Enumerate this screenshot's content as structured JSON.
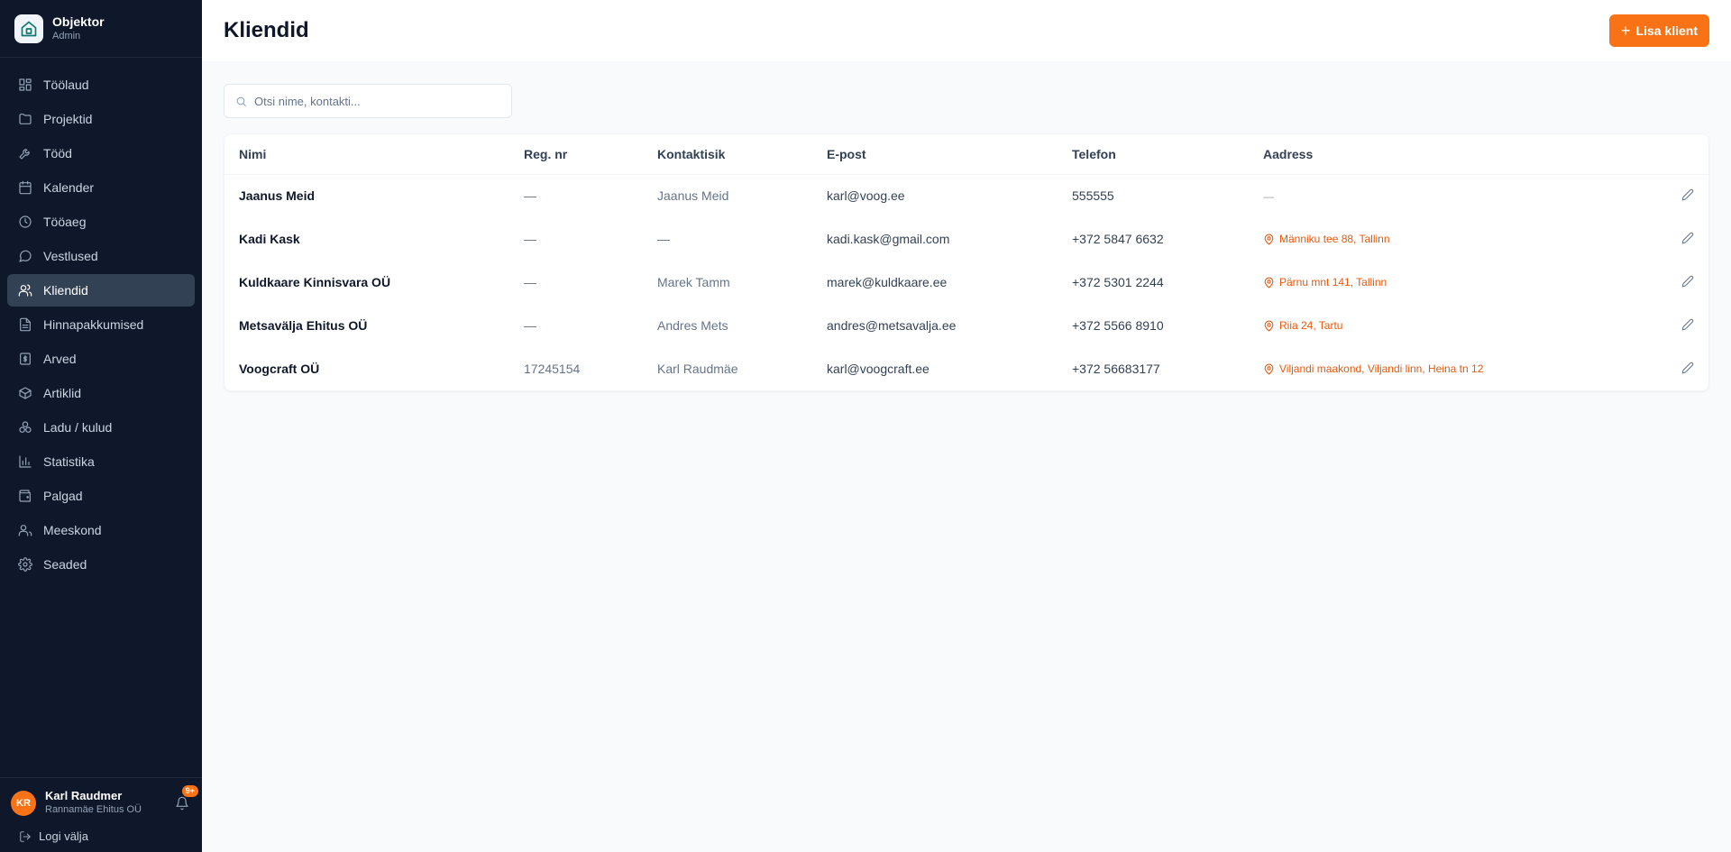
{
  "brand": {
    "name": "Objektor",
    "subtitle": "Admin",
    "logo_icon": "house-icon"
  },
  "sidebar": {
    "items": [
      {
        "label": "Töölaud",
        "icon": "dashboard-icon",
        "active": false
      },
      {
        "label": "Projektid",
        "icon": "folder-icon",
        "active": false
      },
      {
        "label": "Tööd",
        "icon": "wrench-icon",
        "active": false
      },
      {
        "label": "Kalender",
        "icon": "calendar-icon",
        "active": false
      },
      {
        "label": "Tööaeg",
        "icon": "clock-icon",
        "active": false
      },
      {
        "label": "Vestlused",
        "icon": "chat-icon",
        "active": false
      },
      {
        "label": "Kliendid",
        "icon": "users-icon",
        "active": true
      },
      {
        "label": "Hinnapakkumised",
        "icon": "document-icon",
        "active": false
      },
      {
        "label": "Arved",
        "icon": "invoice-icon",
        "active": false
      },
      {
        "label": "Artiklid",
        "icon": "box-icon",
        "active": false
      },
      {
        "label": "Ladu / kulud",
        "icon": "boxes-icon",
        "active": false
      },
      {
        "label": "Statistika",
        "icon": "bar-chart-icon",
        "active": false
      },
      {
        "label": "Palgad",
        "icon": "wallet-icon",
        "active": false
      },
      {
        "label": "Meeskond",
        "icon": "team-icon",
        "active": false
      },
      {
        "label": "Seaded",
        "icon": "gear-icon",
        "active": false
      }
    ]
  },
  "user": {
    "initials": "KR",
    "name": "Karl Raudmer",
    "company": "Rannamäe Ehitus OÜ",
    "notifications": "9+",
    "logout_label": "Logi välja"
  },
  "header": {
    "title": "Kliendid",
    "add_button": "Lisa klient"
  },
  "search": {
    "placeholder": "Otsi nime, kontakti...",
    "value": ""
  },
  "table": {
    "columns": [
      "Nimi",
      "Reg. nr",
      "Kontaktisik",
      "E-post",
      "Telefon",
      "Aadress"
    ],
    "rows": [
      {
        "name": "Jaanus Meid",
        "reg": "—",
        "contact": "Jaanus Meid",
        "email": "karl@voog.ee",
        "phone": "555555",
        "address": "—"
      },
      {
        "name": "Kadi Kask",
        "reg": "—",
        "contact": "—",
        "email": "kadi.kask@gmail.com",
        "phone": "+372 5847 6632",
        "address": "Männiku tee 88, Tallinn"
      },
      {
        "name": "Kuldkaare Kinnisvara OÜ",
        "reg": "—",
        "contact": "Marek Tamm",
        "email": "marek@kuldkaare.ee",
        "phone": "+372 5301 2244",
        "address": "Pärnu mnt 141, Tallinn"
      },
      {
        "name": "Metsavälja Ehitus OÜ",
        "reg": "—",
        "contact": "Andres Mets",
        "email": "andres@metsavalja.ee",
        "phone": "+372 5566 8910",
        "address": "Riia 24, Tartu"
      },
      {
        "name": "Voogcraft OÜ",
        "reg": "17245154",
        "contact": "Karl Raudmäe",
        "email": "karl@voogcraft.ee",
        "phone": "+372 56683177",
        "address": "Viljandi maakond, Viljandi linn, Heina tn 12"
      }
    ]
  },
  "colors": {
    "accent": "#f97316",
    "sidebar_bg": "#0f172a",
    "active_item": "#334155",
    "address": "#ea580c"
  }
}
